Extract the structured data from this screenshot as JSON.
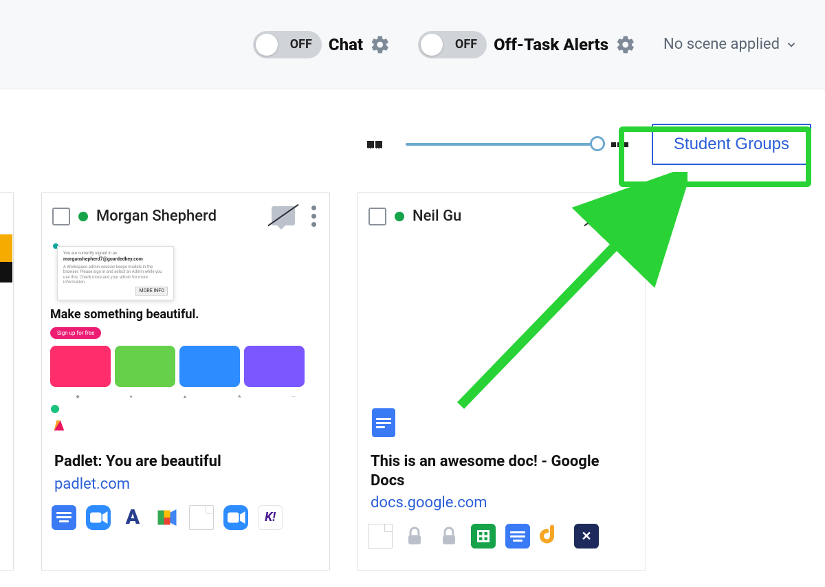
{
  "topbar": {
    "chat_off": "OFF",
    "chat_label": "Chat",
    "alerts_off": "OFF",
    "alerts_label": "Off-Task Alerts",
    "scene_label": "No scene applied"
  },
  "view": {
    "student_groups_label": "Student Groups"
  },
  "cards": [
    {
      "name": "Morgan Shepherd",
      "screenshot_headline": "Make something beautiful.",
      "screenshot_cta": "Sign up for free",
      "title": "Padlet: You are beautiful",
      "url": "padlet.com",
      "tabs": [
        "doc",
        "zoom",
        "a",
        "meet",
        "blank",
        "zoom",
        "kahoot"
      ]
    },
    {
      "name": "Neil Gu",
      "title": "This is an awesome doc! - Google Docs",
      "url": "docs.google.com",
      "tabs": [
        "blank",
        "lock",
        "lock",
        "sheets",
        "doc",
        "jam",
        "x"
      ]
    }
  ]
}
